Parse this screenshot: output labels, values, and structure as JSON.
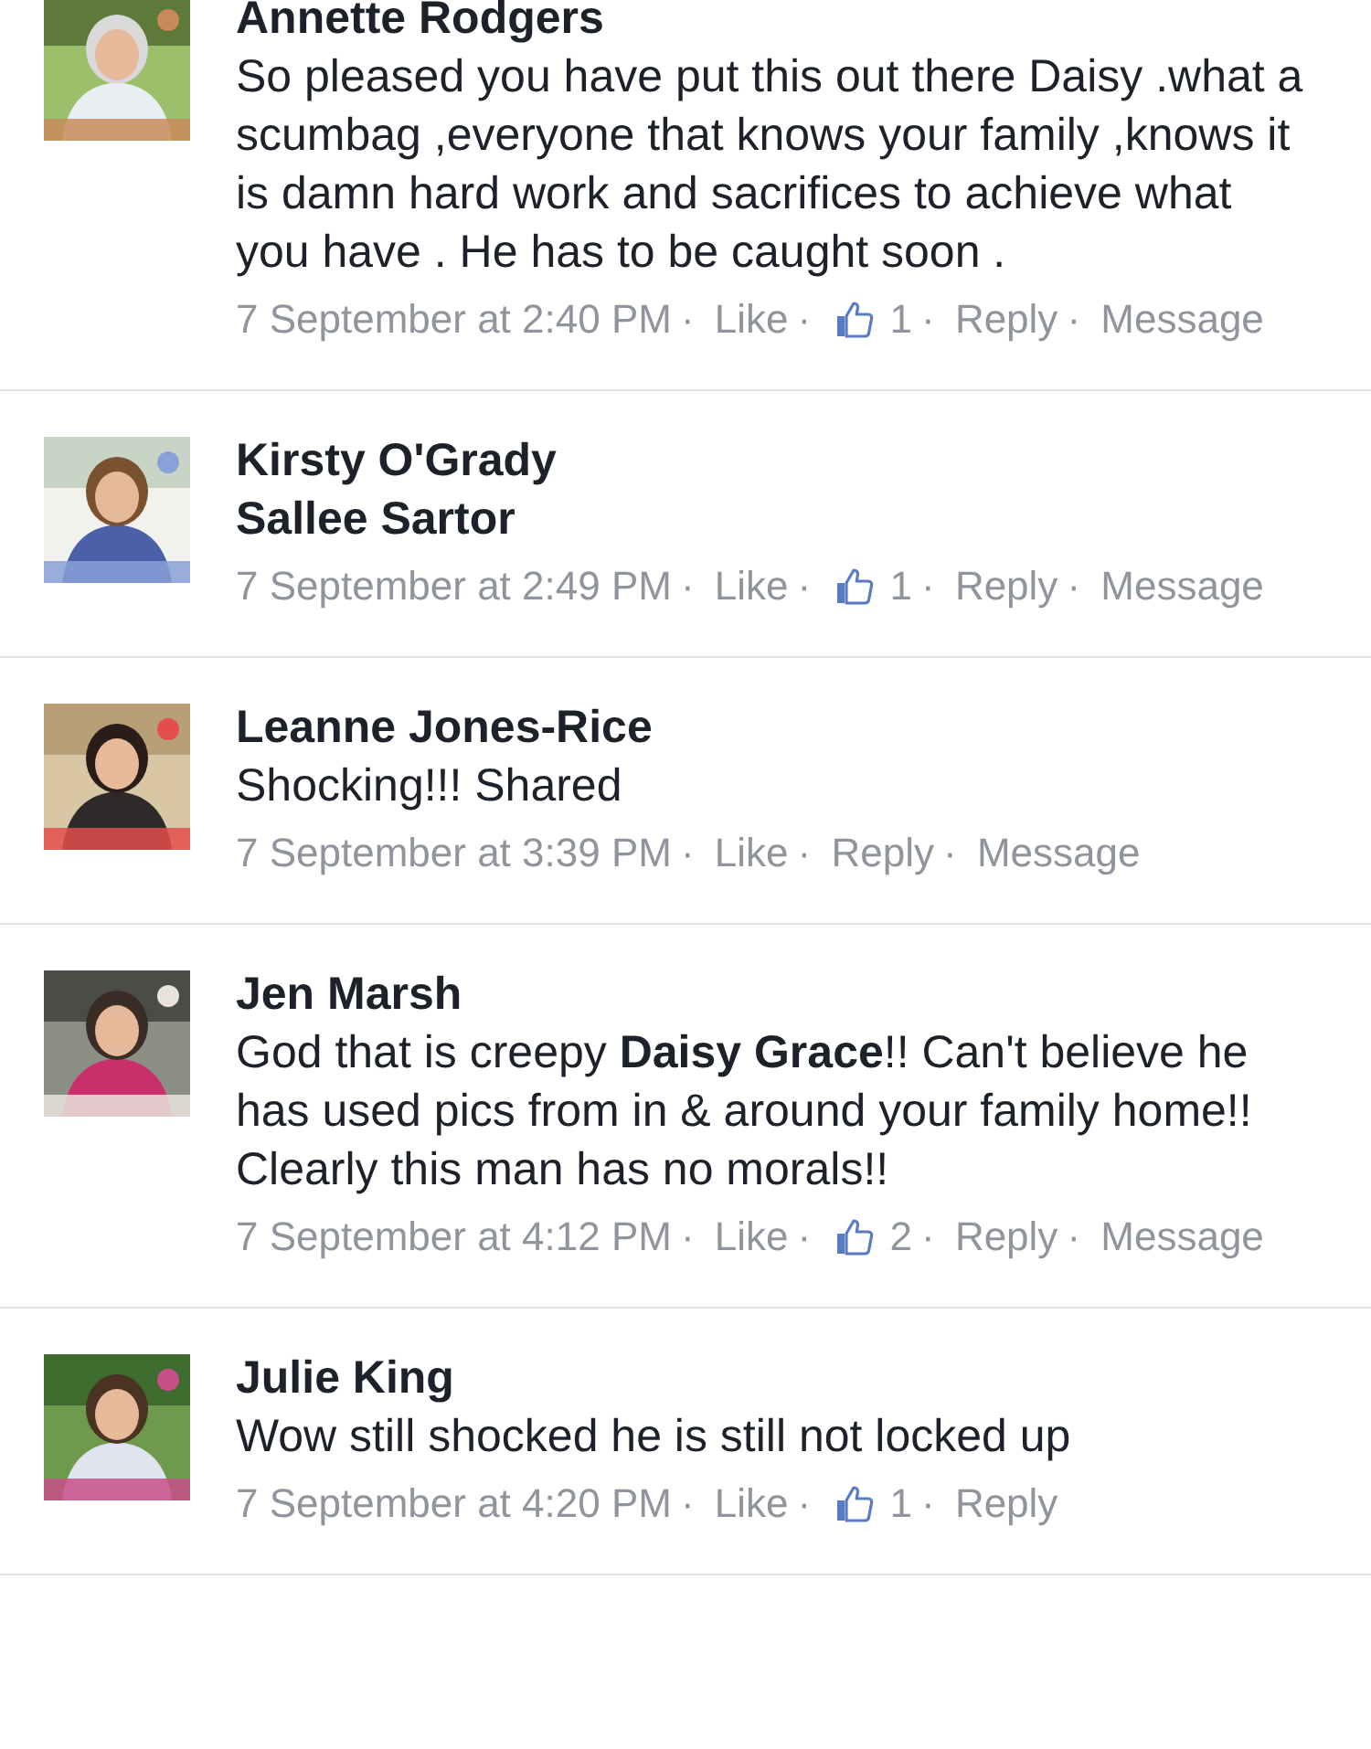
{
  "separator": "·",
  "comments": [
    {
      "author": "Annette Rodgers",
      "body": "So pleased you have put this out there Daisy .what a scumbag ,everyone that knows your family ,knows it is damn hard work and sacrifices to achieve what you have . He has to be caught soon .",
      "tagged": false,
      "meta": [
        {
          "kind": "date",
          "text": "7 September at 2:40 PM"
        },
        {
          "kind": "link",
          "text": "Like"
        },
        {
          "kind": "likes",
          "text": "1"
        },
        {
          "kind": "link",
          "text": "Reply"
        },
        {
          "kind": "link",
          "text": "Message"
        }
      ]
    },
    {
      "author": "Kirsty O'Grady",
      "body": "Sallee Sartor",
      "tagged": true,
      "meta": [
        {
          "kind": "date",
          "text": "7 September at 2:49 PM"
        },
        {
          "kind": "link",
          "text": "Like"
        },
        {
          "kind": "likes",
          "text": "1"
        },
        {
          "kind": "link",
          "text": "Reply"
        },
        {
          "kind": "link",
          "text": "Message"
        }
      ]
    },
    {
      "author": "Leanne Jones-Rice",
      "body": "Shocking!!! Shared",
      "tagged": false,
      "meta": [
        {
          "kind": "date",
          "text": "7 September at 3:39 PM"
        },
        {
          "kind": "link",
          "text": "Like"
        },
        {
          "kind": "link",
          "text": "Reply"
        },
        {
          "kind": "link",
          "text": "Message"
        }
      ]
    },
    {
      "author": "Jen Marsh",
      "body": "God that is creepy **Daisy Grace**!! Can't believe he has used pics from in & around your family home!! Clearly this man has no morals!!",
      "tagged": false,
      "meta": [
        {
          "kind": "date",
          "text": "7 September at 4:12 PM"
        },
        {
          "kind": "link",
          "text": "Like"
        },
        {
          "kind": "likes",
          "text": "2"
        },
        {
          "kind": "link",
          "text": "Reply"
        },
        {
          "kind": "link",
          "text": "Message"
        }
      ]
    },
    {
      "author": "Julie King",
      "body": "Wow still shocked he is still not locked up",
      "tagged": false,
      "meta": [
        {
          "kind": "date",
          "text": "7 September at 4:20 PM"
        },
        {
          "kind": "link",
          "text": "Like"
        },
        {
          "kind": "likes",
          "text": "1"
        },
        {
          "kind": "link",
          "text": "Reply"
        }
      ]
    }
  ]
}
